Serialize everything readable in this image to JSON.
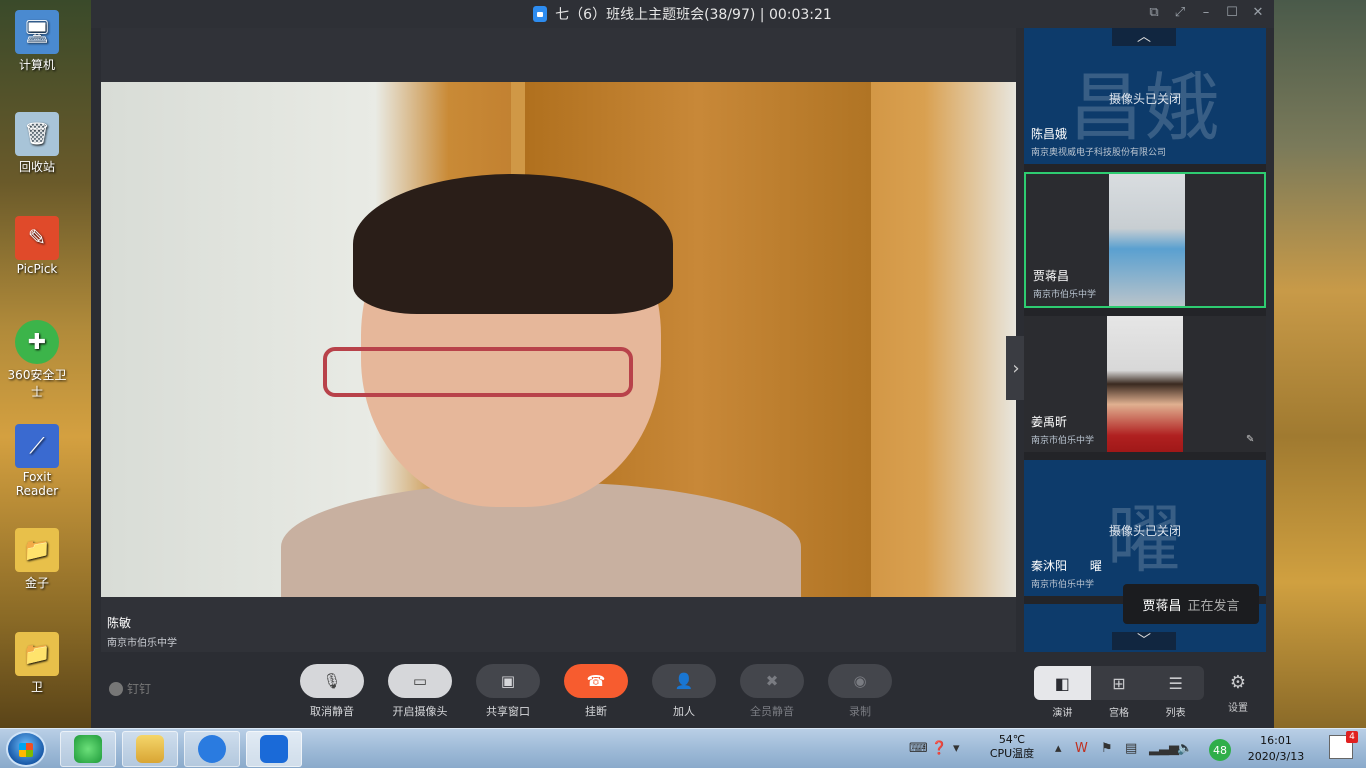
{
  "desktop": {
    "icons": [
      {
        "label": "计算机"
      },
      {
        "label": "回收站"
      },
      {
        "label": "PicPick"
      },
      {
        "label": "360安全卫士"
      },
      {
        "label": "Foxit Reader"
      },
      {
        "label": "金子"
      },
      {
        "label": "卫"
      }
    ]
  },
  "window": {
    "title": "七（6）班线上主题班会(38/97) | 00:03:21"
  },
  "main_video": {
    "speaker_name": "陈敏",
    "speaker_org": "南京市伯乐中学"
  },
  "participants": [
    {
      "name": "陈昌娥",
      "org": "南京奥视威电子科技股份有限公司",
      "camera_off_text": "摄像头已关闭",
      "avatar_text": "昌娥"
    },
    {
      "name": "贾蒋昌",
      "org": "南京市伯乐中学",
      "active": true
    },
    {
      "name": "姜禹昕",
      "org": "南京市伯乐中学"
    },
    {
      "name": "秦沐阳",
      "extra": "曜",
      "org": "南京市伯乐中学",
      "camera_off_text": "摄像头已关闭",
      "avatar_text": "曜"
    }
  ],
  "speaking_toast": {
    "name": "贾蒋昌",
    "status": "正在发言"
  },
  "toolbar": {
    "brand": "钉钉",
    "buttons": [
      {
        "label": "取消静音",
        "icon": "mic-off-icon"
      },
      {
        "label": "开启摄像头",
        "icon": "camera-off-icon"
      },
      {
        "label": "共享窗口",
        "icon": "share-screen-icon"
      },
      {
        "label": "挂断",
        "icon": "hangup-icon"
      },
      {
        "label": "加人",
        "icon": "add-person-icon"
      },
      {
        "label": "全员静音",
        "icon": "mute-all-icon"
      },
      {
        "label": "录制",
        "icon": "record-icon"
      }
    ],
    "layouts": [
      "演讲",
      "宫格",
      "列表"
    ],
    "settings_label": "设置"
  },
  "taskbar": {
    "cpu_temp": "54℃",
    "cpu_label": "CPU温度",
    "badge": "48",
    "time": "16:01",
    "date": "2020/3/13",
    "notification_count": "4"
  }
}
